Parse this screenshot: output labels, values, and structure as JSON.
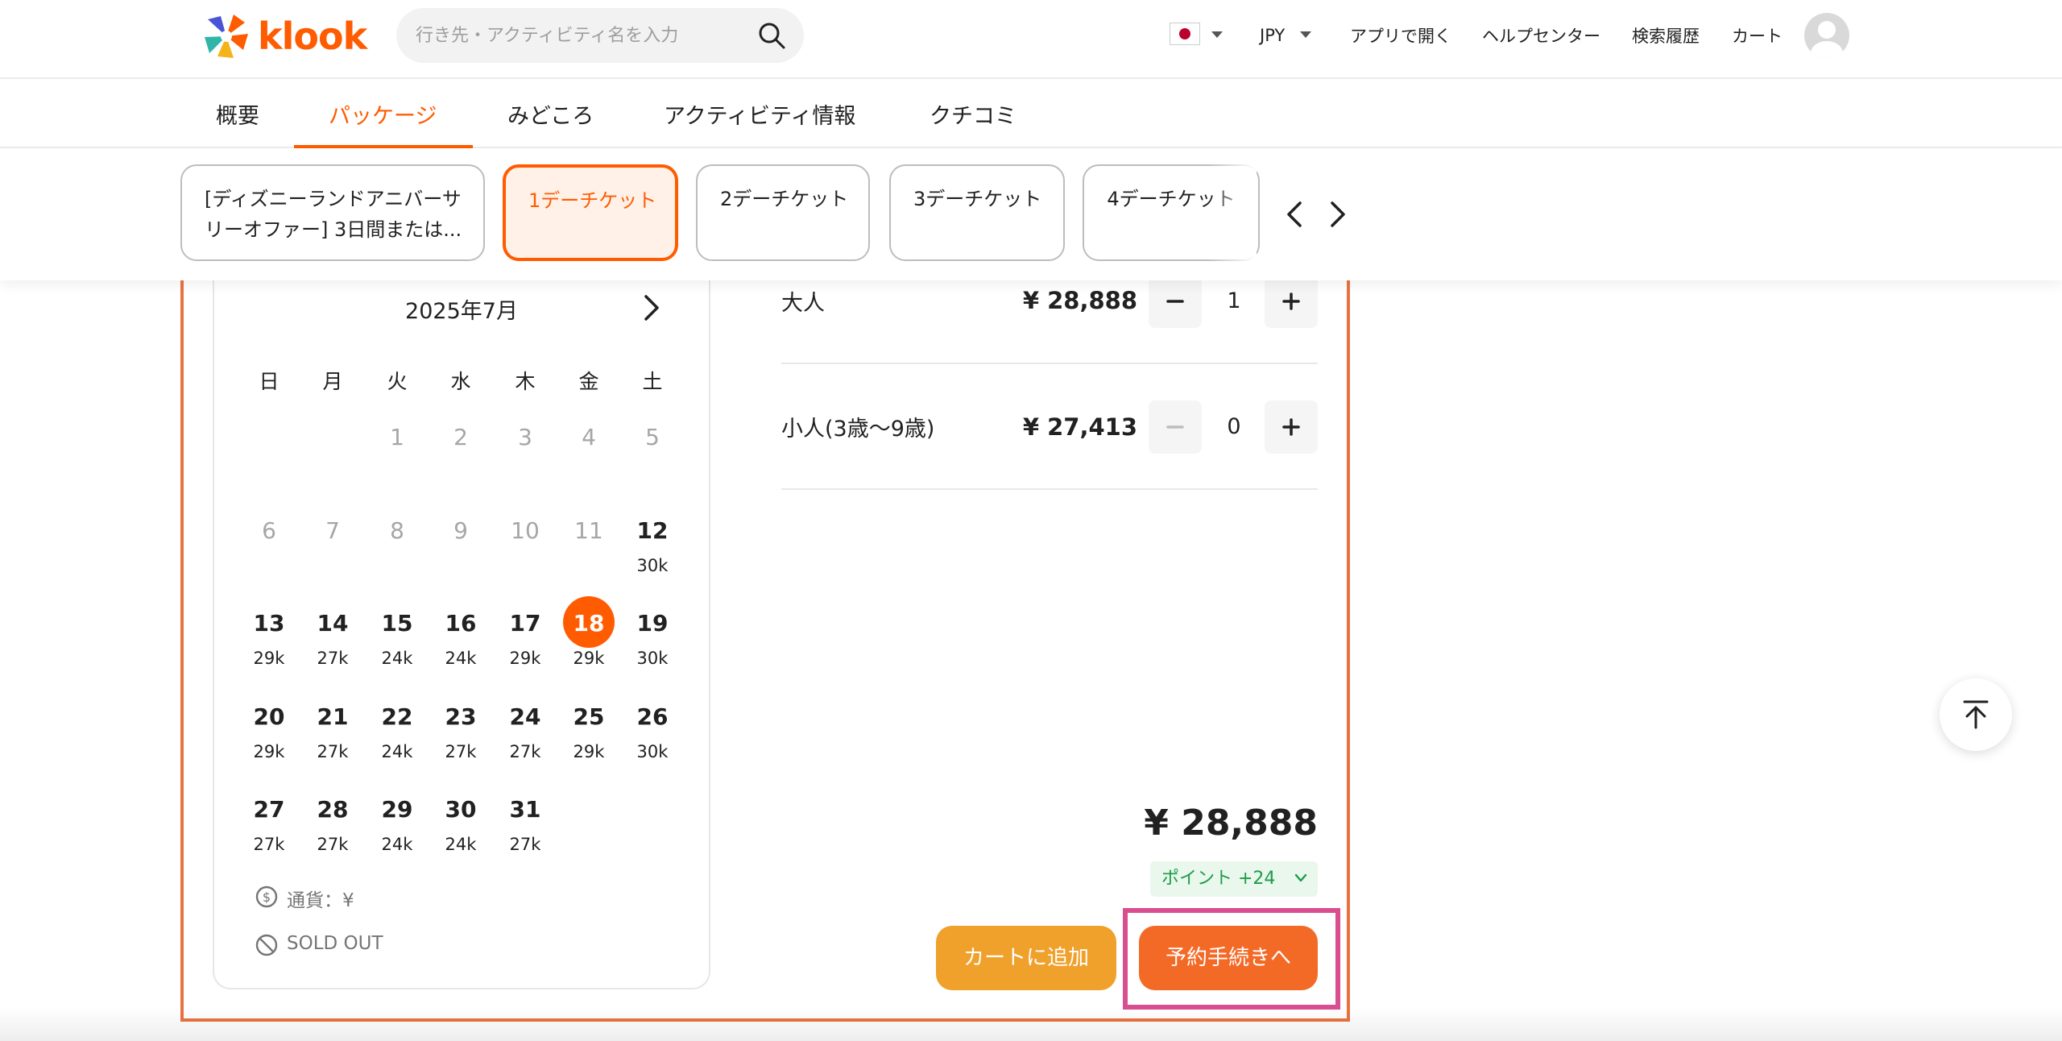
{
  "header": {
    "logo_text": "klook",
    "search_placeholder": "行き先・アクティビティ名を入力",
    "currency": "JPY",
    "nav": [
      "アプリで開く",
      "ヘルプセンター",
      "検索履歴",
      "カート"
    ]
  },
  "tabs": [
    {
      "label": "概要",
      "active": false
    },
    {
      "label": "パッケージ",
      "active": true
    },
    {
      "label": "みどころ",
      "active": false
    },
    {
      "label": "アクティビティ情報",
      "active": false
    },
    {
      "label": "クチコミ",
      "active": false
    }
  ],
  "packages": [
    {
      "line1": "[ディズニーランドアニバーサ",
      "line2": "リーオファー] 3日間または...",
      "active": false
    },
    {
      "line1": "1デーチケット",
      "line2": "",
      "active": true
    },
    {
      "line1": "2デーチケット",
      "line2": "",
      "active": false
    },
    {
      "line1": "3デーチケット",
      "line2": "",
      "active": false
    },
    {
      "line1": "4デーチケット",
      "line2": "",
      "active": false
    }
  ],
  "calendar": {
    "month_title": "2025年7月",
    "weekdays": [
      "日",
      "月",
      "火",
      "水",
      "木",
      "金",
      "土"
    ],
    "selected_day": "18",
    "days": [
      {
        "d": "1",
        "past": true,
        "price": ""
      },
      {
        "d": "2",
        "past": true,
        "price": ""
      },
      {
        "d": "3",
        "past": true,
        "price": ""
      },
      {
        "d": "4",
        "past": true,
        "price": ""
      },
      {
        "d": "5",
        "past": true,
        "price": ""
      },
      {
        "d": "6",
        "past": true,
        "price": ""
      },
      {
        "d": "7",
        "past": true,
        "price": ""
      },
      {
        "d": "8",
        "past": true,
        "price": ""
      },
      {
        "d": "9",
        "past": true,
        "price": ""
      },
      {
        "d": "10",
        "past": true,
        "price": ""
      },
      {
        "d": "11",
        "past": true,
        "price": ""
      },
      {
        "d": "12",
        "past": false,
        "price": "30k"
      },
      {
        "d": "13",
        "past": false,
        "price": "29k"
      },
      {
        "d": "14",
        "past": false,
        "price": "27k"
      },
      {
        "d": "15",
        "past": false,
        "price": "24k"
      },
      {
        "d": "16",
        "past": false,
        "price": "24k"
      },
      {
        "d": "17",
        "past": false,
        "price": "29k"
      },
      {
        "d": "18",
        "past": false,
        "price": "29k"
      },
      {
        "d": "19",
        "past": false,
        "price": "30k"
      },
      {
        "d": "20",
        "past": false,
        "price": "29k"
      },
      {
        "d": "21",
        "past": false,
        "price": "27k"
      },
      {
        "d": "22",
        "past": false,
        "price": "24k"
      },
      {
        "d": "23",
        "past": false,
        "price": "27k"
      },
      {
        "d": "24",
        "past": false,
        "price": "27k"
      },
      {
        "d": "25",
        "past": false,
        "price": "29k"
      },
      {
        "d": "26",
        "past": false,
        "price": "30k"
      },
      {
        "d": "27",
        "past": false,
        "price": "27k"
      },
      {
        "d": "28",
        "past": false,
        "price": "27k"
      },
      {
        "d": "29",
        "past": false,
        "price": "24k"
      },
      {
        "d": "30",
        "past": false,
        "price": "24k"
      },
      {
        "d": "31",
        "past": false,
        "price": "27k"
      }
    ],
    "legend_currency": "通貨：¥",
    "legend_soldout": "SOLD OUT"
  },
  "quantities": [
    {
      "label": "大人",
      "price": "¥ 28,888",
      "value": "1",
      "minus_enabled": true
    },
    {
      "label": "小人(3歳〜9歳)",
      "price": "¥ 27,413",
      "value": "0",
      "minus_enabled": false
    }
  ],
  "total": "¥ 28,888",
  "points": "ポイント +24",
  "buttons": {
    "add_to_cart": "カートに追加",
    "book": "予約手続きへ"
  },
  "colors": {
    "brand": "#ff5b00",
    "cart_button": "#f0a12c",
    "book_button": "#f36a27",
    "highlight": "#d94e8f"
  },
  "icons": [
    "search-icon",
    "flag-japan-icon",
    "chevron-left-icon",
    "chevron-right-icon",
    "dollar-circle-icon",
    "no-entry-icon",
    "minus-icon",
    "plus-icon",
    "chevron-down-icon",
    "scroll-to-top-icon"
  ]
}
